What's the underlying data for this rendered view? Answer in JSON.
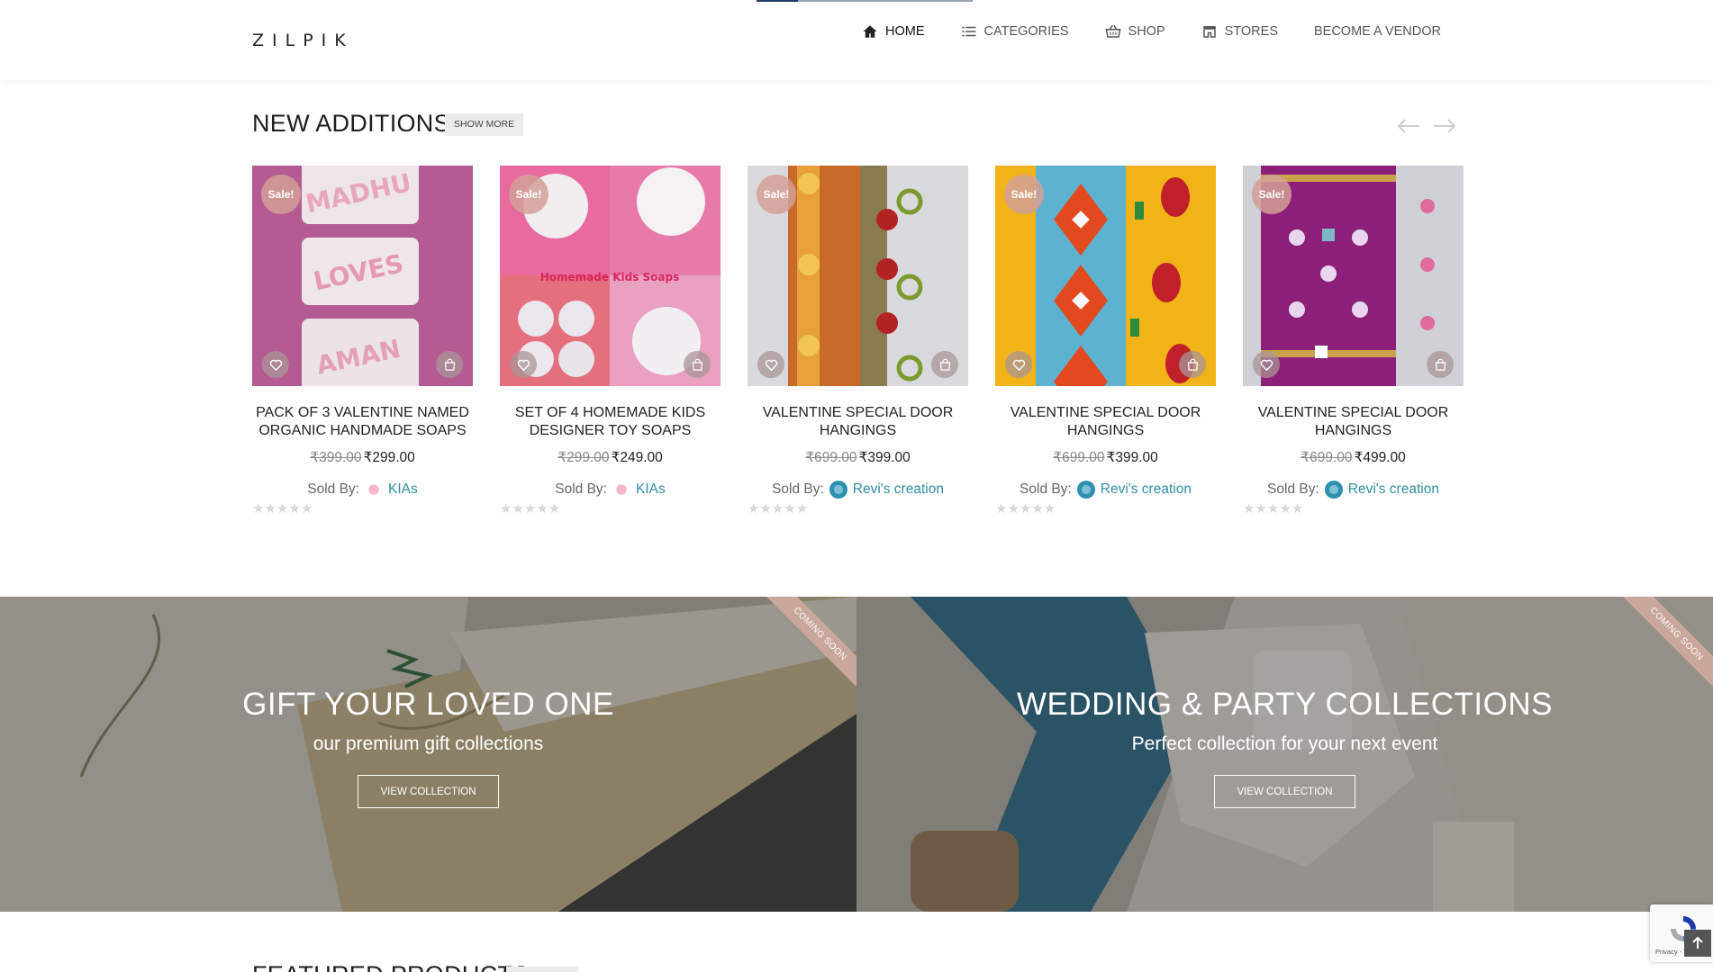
{
  "header": {
    "logo": "ZILPIK",
    "nav": [
      {
        "label": "HOME",
        "icon": "home-icon"
      },
      {
        "label": "CATEGORIES",
        "icon": "list-icon"
      },
      {
        "label": "SHOP",
        "icon": "basket-icon"
      },
      {
        "label": "STORES",
        "icon": "store-icon"
      },
      {
        "label": "BECOME A VENDOR",
        "icon": ""
      }
    ]
  },
  "new_additions": {
    "title": "NEW ADDITIONS",
    "show_more": "SHOW MORE",
    "products": [
      {
        "sale": "Sale!",
        "name": "PACK OF 3 VALENTINE NAMED ORGANIC HANDMADE SOAPS",
        "old_price": "₹399.00",
        "price": "₹299.00",
        "sold_by": "Sold By:",
        "vendor": "KIAs",
        "image_text": [
          "MADHU",
          "LOVES",
          "AMAN"
        ]
      },
      {
        "sale": "Sale!",
        "name": "SET OF 4 HOMEMADE KIDS DESIGNER TOY SOAPS",
        "old_price": "₹299.00",
        "price": "₹249.00",
        "sold_by": "Sold By:",
        "vendor": "KIAs",
        "image_text": [
          "Homemade Kids Soaps"
        ]
      },
      {
        "sale": "Sale!",
        "name": "VALENTINE SPECIAL DOOR HANGINGS",
        "old_price": "₹699.00",
        "price": "₹399.00",
        "sold_by": "Sold By:",
        "vendor": "Revi's creation"
      },
      {
        "sale": "Sale!",
        "name": "VALENTINE SPECIAL DOOR HANGINGS",
        "old_price": "₹699.00",
        "price": "₹399.00",
        "sold_by": "Sold By:",
        "vendor": "Revi's creation"
      },
      {
        "sale": "Sale!",
        "name": "VALENTINE SPECIAL DOOR HANGINGS",
        "old_price": "₹699.00",
        "price": "₹499.00",
        "sold_by": "Sold By:",
        "vendor": "Revi's creation"
      }
    ]
  },
  "banners": [
    {
      "title": "GIFT YOUR LOVED ONE",
      "subtitle": "our premium gift collections",
      "button": "VIEW COLLECTION",
      "ribbon": "COMING SOON"
    },
    {
      "title": "WEDDING & PARTY COLLECTIONS",
      "subtitle": "Perfect collection for your next event",
      "button": "VIEW COLLECTION",
      "ribbon": "COMING SOON"
    }
  ],
  "featured": {
    "title": "FEATURED PRODUCTS"
  },
  "recaptcha": {
    "text": "Privacy - Terms"
  },
  "colors": {
    "vendor_link": "#2f8fa3",
    "sale_badge": "#d4a096",
    "ribbon": "#c9a79a"
  }
}
